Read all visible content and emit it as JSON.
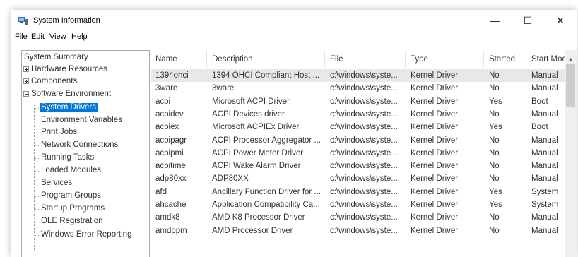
{
  "window": {
    "title": "System Information",
    "minimize_glyph": "—",
    "maximize_glyph": "☐",
    "close_glyph": "✕"
  },
  "menu": [
    {
      "label": "File",
      "underline": "F",
      "rest": "ile"
    },
    {
      "label": "Edit",
      "underline": "E",
      "rest": "dit"
    },
    {
      "label": "View",
      "underline": "V",
      "rest": "iew"
    },
    {
      "label": "Help",
      "underline": "H",
      "rest": "elp"
    }
  ],
  "tree": [
    {
      "label": "System Summary",
      "level": 0
    },
    {
      "label": "Hardware Resources",
      "level": 1,
      "expander": "plus"
    },
    {
      "label": "Components",
      "level": 1,
      "expander": "plus"
    },
    {
      "label": "Software Environment",
      "level": 1,
      "expander": "minus"
    },
    {
      "label": "System Drivers",
      "level": 2,
      "selected": true
    },
    {
      "label": "Environment Variables",
      "level": 2
    },
    {
      "label": "Print Jobs",
      "level": 2
    },
    {
      "label": "Network Connections",
      "level": 2
    },
    {
      "label": "Running Tasks",
      "level": 2
    },
    {
      "label": "Loaded Modules",
      "level": 2
    },
    {
      "label": "Services",
      "level": 2
    },
    {
      "label": "Program Groups",
      "level": 2
    },
    {
      "label": "Startup Programs",
      "level": 2
    },
    {
      "label": "OLE Registration",
      "level": 2
    },
    {
      "label": "Windows Error Reporting",
      "level": 2
    }
  ],
  "columns": [
    "Name",
    "Description",
    "File",
    "Type",
    "Started",
    "Start Mode"
  ],
  "rows": [
    [
      "1394ohci",
      "1394 OHCI Compliant Host ...",
      "c:\\windows\\syste...",
      "Kernel Driver",
      "No",
      "Manual"
    ],
    [
      "3ware",
      "3ware",
      "c:\\windows\\syste...",
      "Kernel Driver",
      "No",
      "Manual"
    ],
    [
      "acpi",
      "Microsoft ACPI Driver",
      "c:\\windows\\syste...",
      "Kernel Driver",
      "Yes",
      "Boot"
    ],
    [
      "acpidev",
      "ACPI Devices driver",
      "c:\\windows\\syste...",
      "Kernel Driver",
      "No",
      "Manual"
    ],
    [
      "acpiex",
      "Microsoft ACPIEx Driver",
      "c:\\windows\\syste...",
      "Kernel Driver",
      "Yes",
      "Boot"
    ],
    [
      "acpipagr",
      "ACPI Processor Aggregator ...",
      "c:\\windows\\syste...",
      "Kernel Driver",
      "No",
      "Manual"
    ],
    [
      "acpipmi",
      "ACPI Power Meter Driver",
      "c:\\windows\\syste...",
      "Kernel Driver",
      "No",
      "Manual"
    ],
    [
      "acpitime",
      "ACPI Wake Alarm Driver",
      "c:\\windows\\syste...",
      "Kernel Driver",
      "No",
      "Manual"
    ],
    [
      "adp80xx",
      "ADP80XX",
      "c:\\windows\\syste...",
      "Kernel Driver",
      "No",
      "Manual"
    ],
    [
      "afd",
      "Ancillary Function Driver for ...",
      "c:\\windows\\syste...",
      "Kernel Driver",
      "Yes",
      "System"
    ],
    [
      "ahcache",
      "Application Compatibility Ca...",
      "c:\\windows\\syste...",
      "Kernel Driver",
      "Yes",
      "System"
    ],
    [
      "amdk8",
      "AMD K8 Processor Driver",
      "c:\\windows\\syste...",
      "Kernel Driver",
      "No",
      "Manual"
    ],
    [
      "amdppm",
      "AMD Processor Driver",
      "c:\\windows\\syste...",
      "Kernel Driver",
      "No",
      "Manual"
    ]
  ],
  "selected_row_index": 0,
  "colors": {
    "selection": "#0078d7",
    "row_highlight": "#e8e8e8"
  }
}
